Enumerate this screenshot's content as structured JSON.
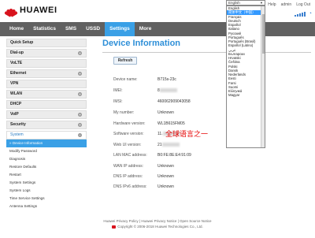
{
  "header": {
    "brand": "HUAWEI",
    "links": [
      "Help",
      "admin",
      "Log Out"
    ]
  },
  "lang_dropdown": {
    "selected": "English",
    "options": [
      "English",
      "简体中文（中国）",
      "Français",
      "Deutsch",
      "Español",
      "Italiano",
      "Русский",
      "Português",
      "Português (Brasil)",
      "Español (Latino)",
      "عربي",
      "Български",
      "Hrvatski",
      "Čeština",
      "Polski",
      "Dansk",
      "Nederlands",
      "Eesti",
      "Farsi",
      "Suomi",
      "Ελληνικά",
      "Magyar"
    ],
    "highlighted": "简体中文（中国）"
  },
  "nav": {
    "items": [
      "Home",
      "Statistics",
      "SMS",
      "USSD",
      "Settings",
      "More"
    ],
    "active": "Settings"
  },
  "sidebar": {
    "sections": [
      {
        "label": "Quick Setup",
        "expand": false
      },
      {
        "label": "Dial-up",
        "expand": true
      },
      {
        "label": "VoLTE",
        "expand": false
      },
      {
        "label": "Ethernet",
        "expand": true
      },
      {
        "label": "VPN",
        "expand": false
      },
      {
        "label": "WLAN",
        "expand": true
      },
      {
        "label": "DHCP",
        "expand": false
      },
      {
        "label": "VoIP",
        "expand": true
      },
      {
        "label": "Security",
        "expand": true
      }
    ],
    "system": {
      "label": "System",
      "items": [
        "Device Information",
        "Modify Password",
        "Diagnosis",
        "Restore Defaults",
        "Restart",
        "System Settings",
        "System Logs",
        "Time Service Settings",
        "Antenna Settings"
      ],
      "active": "Device Information"
    }
  },
  "main": {
    "title": "Device Information",
    "refresh_label": "Refresh",
    "rows": [
      {
        "label": "Device name:",
        "value": "B715s-23c"
      },
      {
        "label": "IMEI:",
        "value": "8"
      },
      {
        "label": "IMSI:",
        "value": "460062909043058"
      },
      {
        "label": "My number:",
        "value": "Unknown"
      },
      {
        "label": "Hardware version:",
        "value": "WL1B615FM05"
      },
      {
        "label": "Software version:",
        "value": "11."
      },
      {
        "label": "Web UI version:",
        "value": "21"
      },
      {
        "label": "LAN MAC address:",
        "value": "B0:FE:8E:E4:91:09"
      },
      {
        "label": "WAN IP address:",
        "value": "Unknown"
      },
      {
        "label": "DNS IP address:",
        "value": "Unknown"
      },
      {
        "label": "DNS IPv6 address:",
        "value": "Unknown"
      }
    ],
    "annotation": "全球语言之一"
  },
  "footer": {
    "links": "Huawei Privacy Policy | Huawei Privacy Notice | Open Source Notice",
    "copyright": "Copyright © 2006-2018 Huawei Technologies Co., Ltd."
  },
  "colors": {
    "accent": "#3aa0e6",
    "nav_bg": "#616161",
    "brand_red": "#d8131d",
    "annotation": "#e60000"
  }
}
